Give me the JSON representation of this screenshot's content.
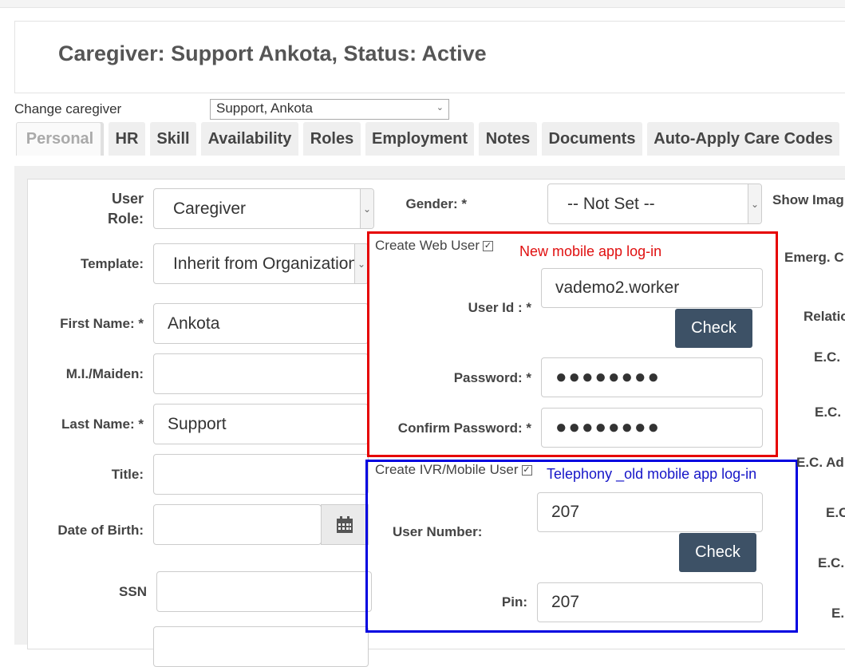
{
  "header": {
    "title": "Caregiver: Support Ankota, Status: Active"
  },
  "change_caregiver": {
    "label": "Change caregiver",
    "selected": "Support, Ankota"
  },
  "tabs": [
    {
      "label": "Personal",
      "active": true
    },
    {
      "label": "HR"
    },
    {
      "label": "Skill"
    },
    {
      "label": "Availability"
    },
    {
      "label": "Roles"
    },
    {
      "label": "Employment"
    },
    {
      "label": "Notes"
    },
    {
      "label": "Documents"
    },
    {
      "label": "Auto-Apply Care Codes"
    }
  ],
  "form": {
    "user_role": {
      "label_line1": "User",
      "label_line2": "Role:",
      "value": "Caregiver"
    },
    "template": {
      "label": "Template:",
      "value": "Inherit from Organization"
    },
    "first_name": {
      "label": "First Name: *",
      "value": "Ankota"
    },
    "mi_maiden": {
      "label": "M.I./Maiden:",
      "value": ""
    },
    "last_name": {
      "label": "Last Name: *",
      "value": "Support"
    },
    "title": {
      "label": "Title:",
      "value": ""
    },
    "dob": {
      "label": "Date of Birth:",
      "value": ""
    },
    "ssn": {
      "label": "SSN",
      "value": ""
    },
    "gender": {
      "label": "Gender: *",
      "value": "-- Not Set --"
    }
  },
  "web_user": {
    "checkbox_label": "Create Web User",
    "checked": true,
    "annotation": "New mobile app log-in",
    "user_id": {
      "label": "User Id : *",
      "value": "vademo2.worker"
    },
    "check_button": "Check",
    "password": {
      "label": "Password: *",
      "value": "●●●●●●●●"
    },
    "confirm_password": {
      "label": "Confirm Password: *",
      "value": "●●●●●●●●"
    }
  },
  "ivr_user": {
    "checkbox_label": "Create IVR/Mobile User",
    "checked": true,
    "annotation": "Telephony _old mobile app log-in",
    "user_number": {
      "label": "User Number:",
      "value": "207"
    },
    "check_button": "Check",
    "pin": {
      "label": "Pin:",
      "value": "207"
    }
  },
  "right_column_labels": {
    "show_image": "Show Imag",
    "emerg": "Emerg. C",
    "relation": "Relatio",
    "ec1": "E.C.",
    "ec2": "E.C.",
    "ec_address": "E.C. Ad",
    "ec3": "E.C",
    "ec4": "E.C.",
    "ec5": "E."
  },
  "colors": {
    "button": "#3d5166",
    "red_annotation": "#e01010",
    "blue_annotation": "#1515c8"
  }
}
